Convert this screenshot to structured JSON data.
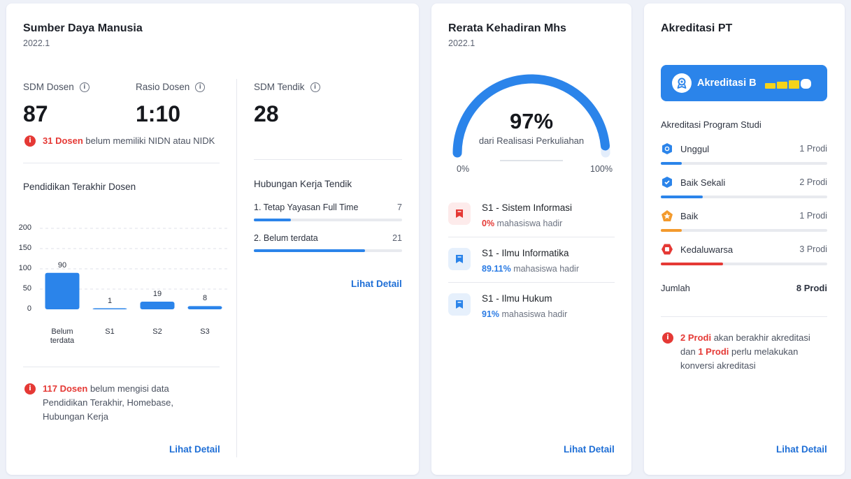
{
  "sdm": {
    "title": "Sumber Daya Manusia",
    "period": "2022.1",
    "dosen_label": "SDM Dosen",
    "dosen_value": "87",
    "rasio_label": "Rasio Dosen",
    "rasio_value": "1:10",
    "tendik_label": "SDM Tendik",
    "tendik_value": "28",
    "nidn_alert_count": "31 Dosen",
    "nidn_alert_text": " belum memiliki NIDN atau NIDK",
    "pendidikan_title": "Pendidikan Terakhir Dosen",
    "missing_alert_count": "117 Dosen",
    "missing_alert_text": " belum mengisi data Pendidikan Terakhir, Homebase, Hubungan Kerja",
    "hubungan_title": "Hubungan Kerja Tendik",
    "hubungan_items": [
      {
        "label": "1. Tetap Yayasan Full Time",
        "count": "7",
        "fraction": 0.25
      },
      {
        "label": "2. Belum terdata",
        "count": "21",
        "fraction": 0.75
      }
    ],
    "detail_link": "Lihat Detail",
    "detail_link_left": "Lihat Detail"
  },
  "chart_data": {
    "type": "bar",
    "categories": [
      "Belum terdata",
      "S1",
      "S2",
      "S3"
    ],
    "category_lines": [
      [
        "Belum",
        "terdata"
      ],
      [
        "S1"
      ],
      [
        "S2"
      ],
      [
        "S3"
      ]
    ],
    "values": [
      90,
      1,
      19,
      8
    ],
    "value_labels": [
      "90",
      "1",
      "19",
      "8"
    ],
    "yticks": [
      0,
      50,
      100,
      150,
      200
    ],
    "ylim": [
      0,
      200
    ],
    "grid": true,
    "title": "",
    "xlabel": "",
    "ylabel": "",
    "bar_color": "#2b84ea"
  },
  "kehadiran": {
    "title": "Rerata Kehadiran Mhs",
    "period": "2022.1",
    "percent": "97%",
    "percent_value": 97,
    "caption": "dari Realisasi Perkuliahan",
    "min_label": "0%",
    "max_label": "100%",
    "prodi": [
      {
        "name": "S1 - Sistem Informasi",
        "pct": "0%",
        "suffix": " mahasiswa hadir",
        "status": "low",
        "icon": "bookmark-icon"
      },
      {
        "name": "S1 - Ilmu Informatika",
        "pct": "89.11%",
        "suffix": " mahasiswa hadir",
        "status": "ok",
        "icon": "bookmark-icon"
      },
      {
        "name": "S1 - Ilmu Hukum",
        "pct": "91%",
        "suffix": " mahasiswa hadir",
        "status": "ok",
        "icon": "bookmark-icon"
      }
    ],
    "detail_link": "Lihat Detail"
  },
  "akreditasi": {
    "title": "Akreditasi PT",
    "banner_label": "Akreditasi B",
    "banner_level": 3,
    "banner_levels": 4,
    "banner_icon": "award-icon",
    "program_title": "Akreditasi Program Studi",
    "items": [
      {
        "label": "Unggul",
        "count": "1 Prodi",
        "fraction": 0.125,
        "color": "#2b84ea",
        "icon": "shield-badge-icon"
      },
      {
        "label": "Baik Sekali",
        "count": "2 Prodi",
        "fraction": 0.25,
        "color": "#2b84ea",
        "icon": "shield-badge-icon"
      },
      {
        "label": "Baik",
        "count": "1 Prodi",
        "fraction": 0.125,
        "color": "#f39a2d",
        "icon": "pentagon-badge-icon"
      },
      {
        "label": "Kedaluwarsa",
        "count": "3 Prodi",
        "fraction": 0.375,
        "color": "#e53935",
        "icon": "hexagon-badge-icon"
      }
    ],
    "total_label": "Jumlah",
    "total_value": "8 Prodi",
    "alert_count1": "2 Prodi",
    "alert_text1": " akan berakhir akreditasi dan ",
    "alert_count2": "1 Prodi",
    "alert_text2": " perlu melakukan konversi akreditasi",
    "detail_link": "Lihat Detail"
  },
  "colors": {
    "primary": "#2b84ea",
    "danger": "#e53935",
    "warning": "#f39a2d",
    "gauge_track": "#e3edfb"
  }
}
